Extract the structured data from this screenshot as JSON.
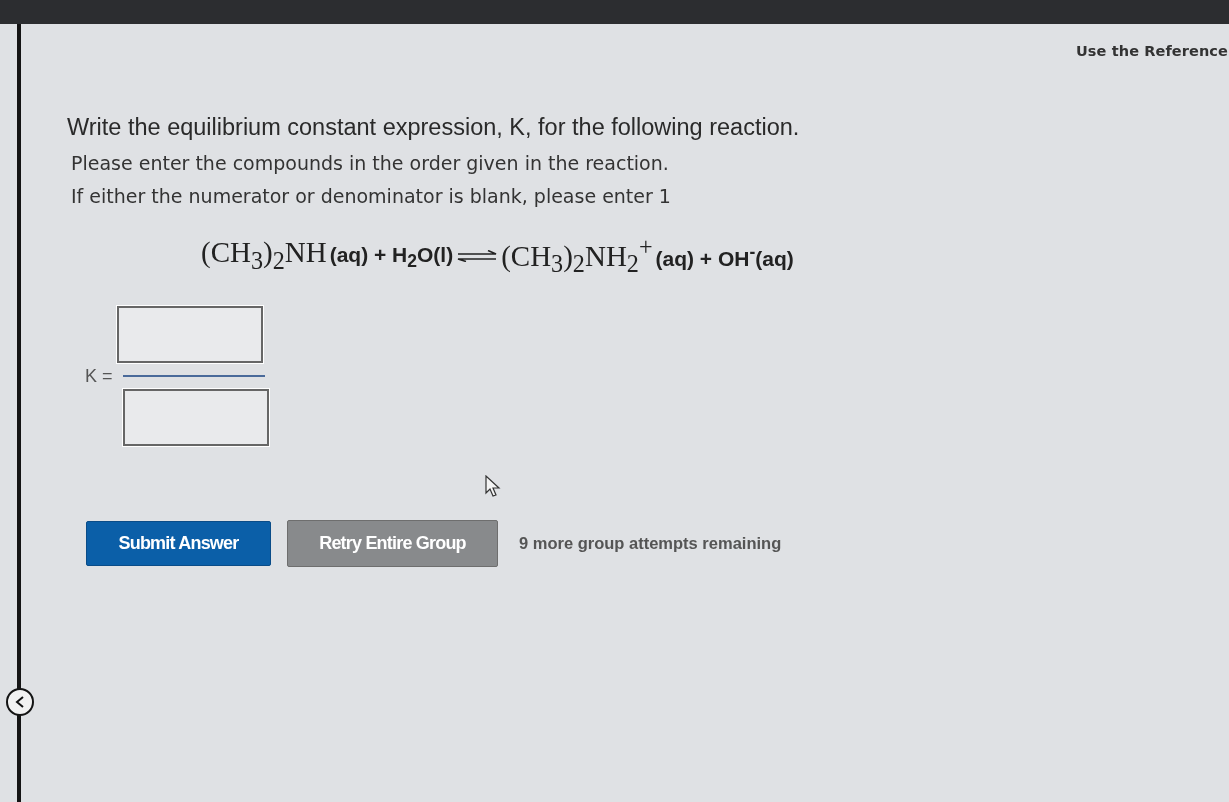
{
  "top_link": "Use the Reference",
  "question": {
    "title": "Write the equilibrium constant expression, K, for the following reaction.",
    "instructions": [
      "Please enter the compounds in the order given in the reaction.",
      "If either the numerator or denominator is blank, please enter 1"
    ]
  },
  "equation": {
    "reactants": [
      {
        "kind": "serif",
        "text": "(CH$_{3}$)$_{2}$NH"
      },
      {
        "kind": "sans",
        "text": "(aq) + H$_{2}$O(l)"
      }
    ],
    "products": [
      {
        "kind": "serif",
        "text": "(CH$_{3}$)$_{2}$NH$_{2}$$^{+}$"
      },
      {
        "kind": "sans",
        "text": "(aq) + OH$^{-}$(aq)"
      }
    ]
  },
  "expression": {
    "label": "K ="
  },
  "buttons": [
    {
      "label": "Submit Answer",
      "kind": "primary"
    },
    {
      "label": "Retry Entire Group",
      "kind": "secondary"
    }
  ],
  "attempts": "9 more group attempts remaining"
}
